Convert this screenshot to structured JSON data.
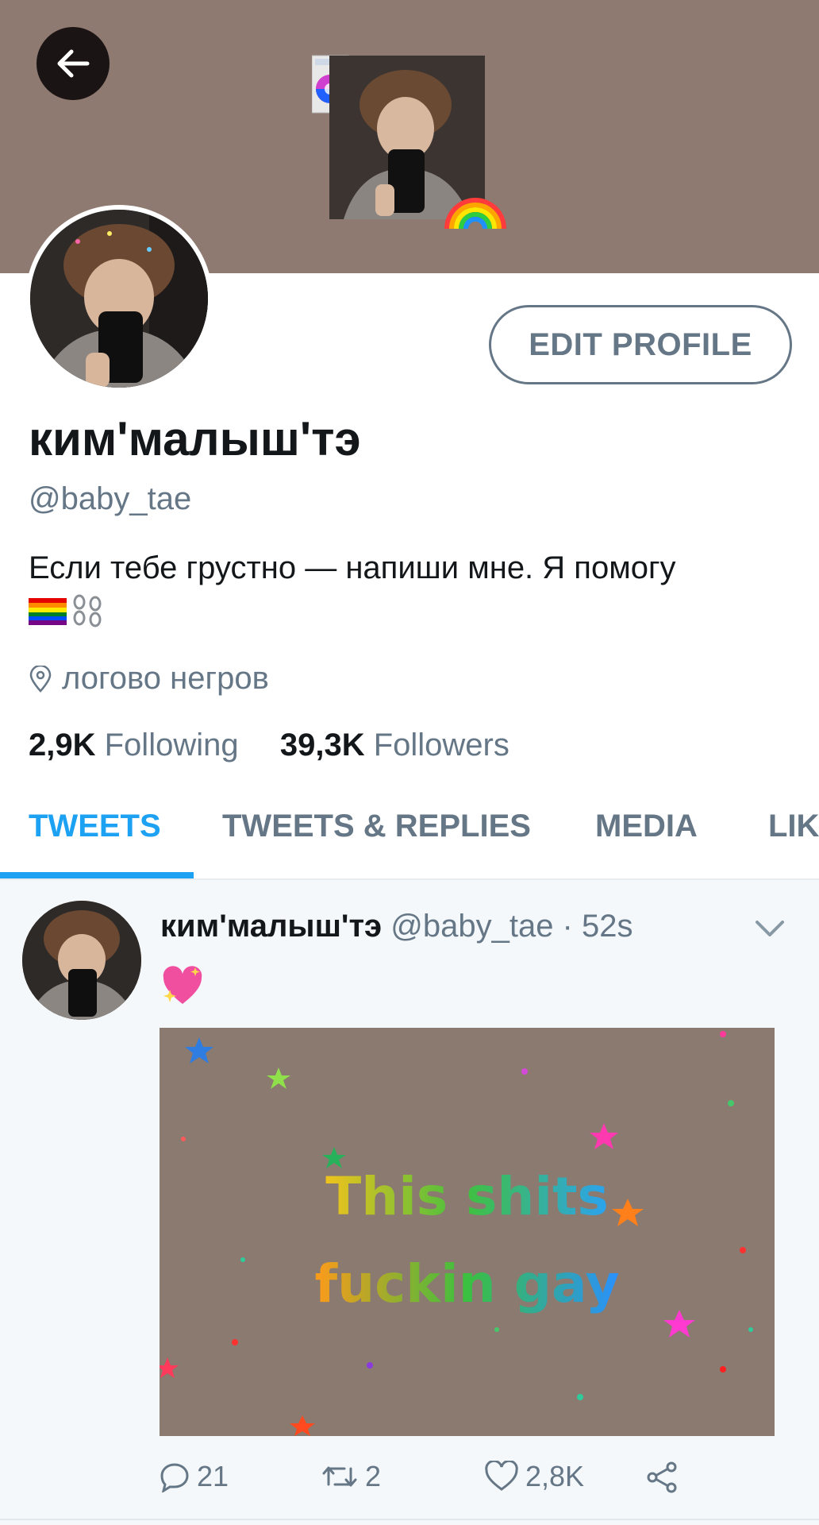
{
  "theme": {
    "banner": "#8e7a70",
    "accent": "#1da1f2",
    "muted": "#657786"
  },
  "header": {
    "back_icon": "arrow-left-icon"
  },
  "profile": {
    "edit_label": "EDIT PROFILE",
    "display_name": "ким'малыш'тэ",
    "handle": "@baby_tae",
    "bio": "Если тебе грустно — напиши мне. Я помогу",
    "bio_emoji": [
      "rainbow-flag",
      "chains"
    ],
    "location": "логово негров",
    "following_count": "2,9K",
    "following_label": "Following",
    "followers_count": "39,3K",
    "followers_label": "Followers"
  },
  "tabs": [
    "TWEETS",
    "TWEETS & REPLIES",
    "MEDIA",
    "LIK"
  ],
  "tweet": {
    "name": "ким'малыш'тэ",
    "meta": "@baby_tae · 52s",
    "emoji": "sparkling-heart",
    "media_line1": "This shits",
    "media_line2": "fuckin gay",
    "replies": "21",
    "retweets": "2",
    "likes": "2,8K"
  }
}
